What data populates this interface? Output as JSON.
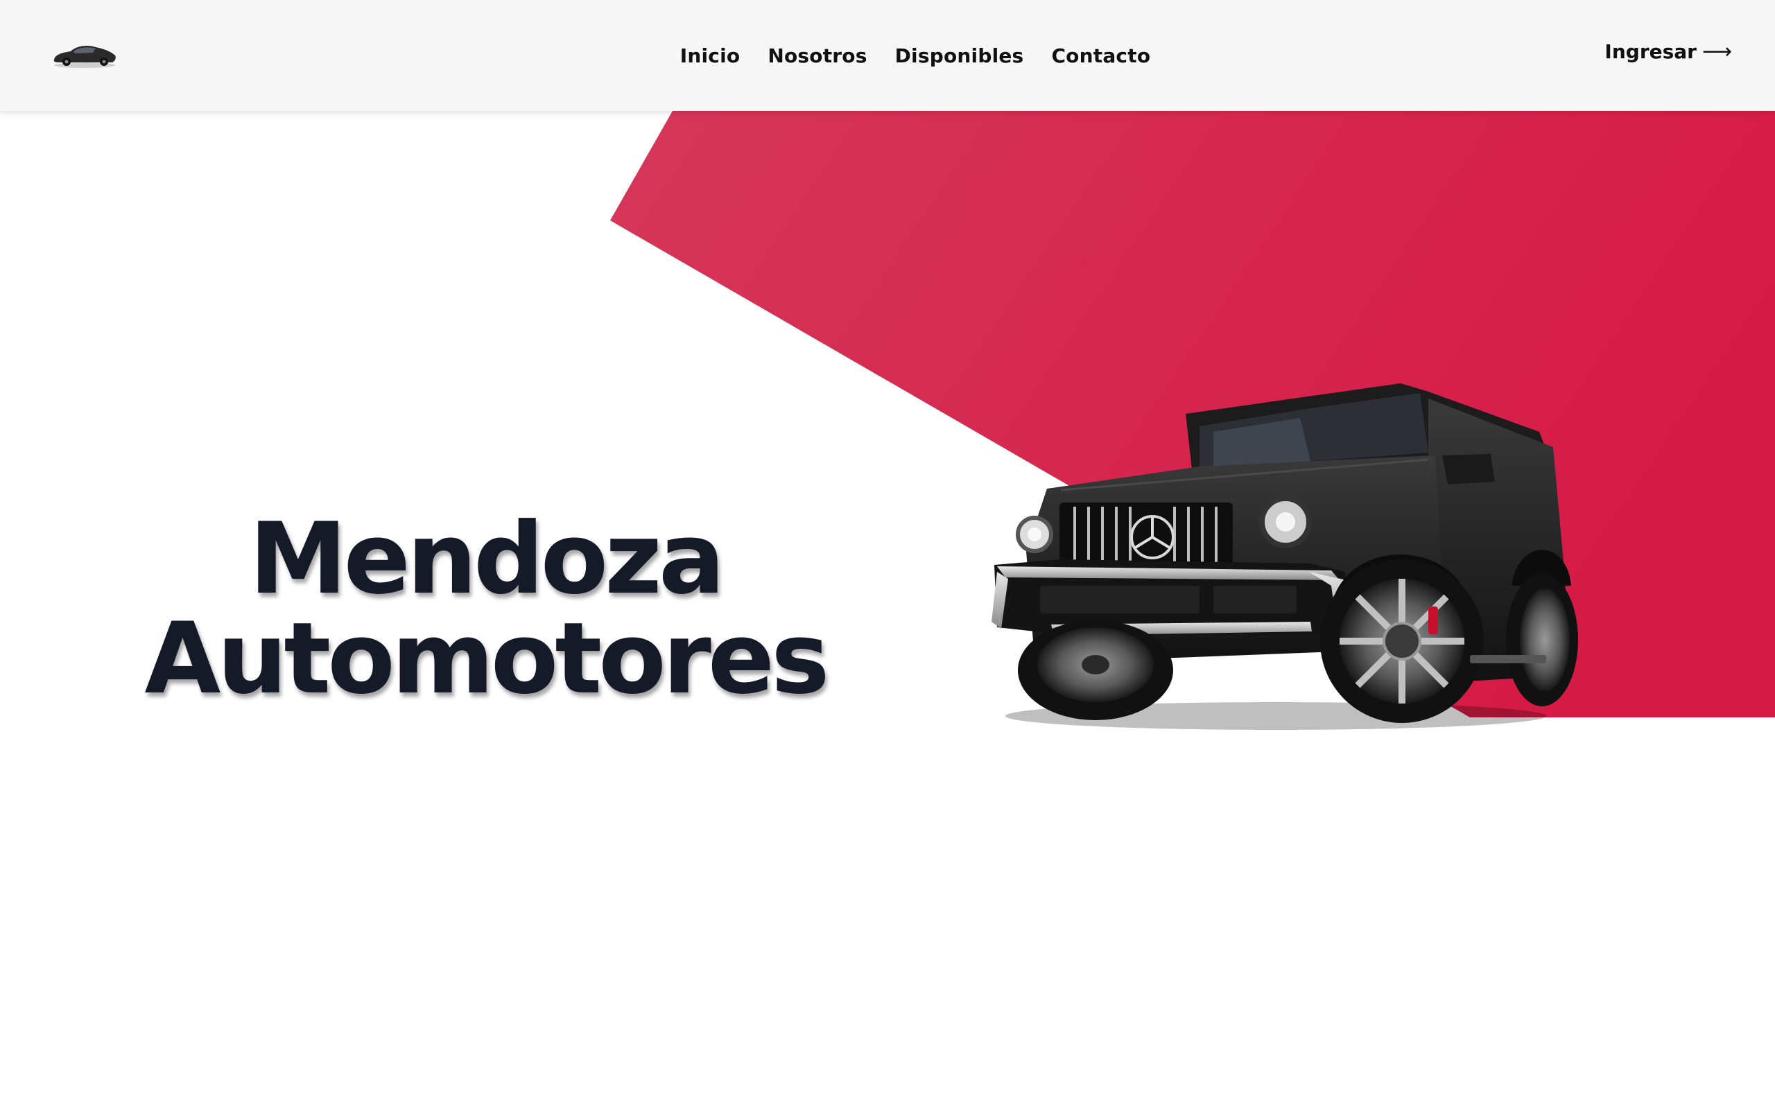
{
  "header": {
    "logo_icon": "car-logo-icon",
    "nav": [
      {
        "label": "Inicio"
      },
      {
        "label": "Nosotros"
      },
      {
        "label": "Disponibles"
      },
      {
        "label": "Contacto"
      }
    ],
    "login": {
      "label": "Ingresar",
      "arrow": "⟶"
    }
  },
  "hero": {
    "title_line1": "Mendoza",
    "title_line2": "Automotores",
    "car_icon": "suv-car-image"
  },
  "colors": {
    "accent": "#d61f4a",
    "accent_light": "#d53759",
    "title": "#151a28",
    "header_bg": "#f6f6f6"
  }
}
